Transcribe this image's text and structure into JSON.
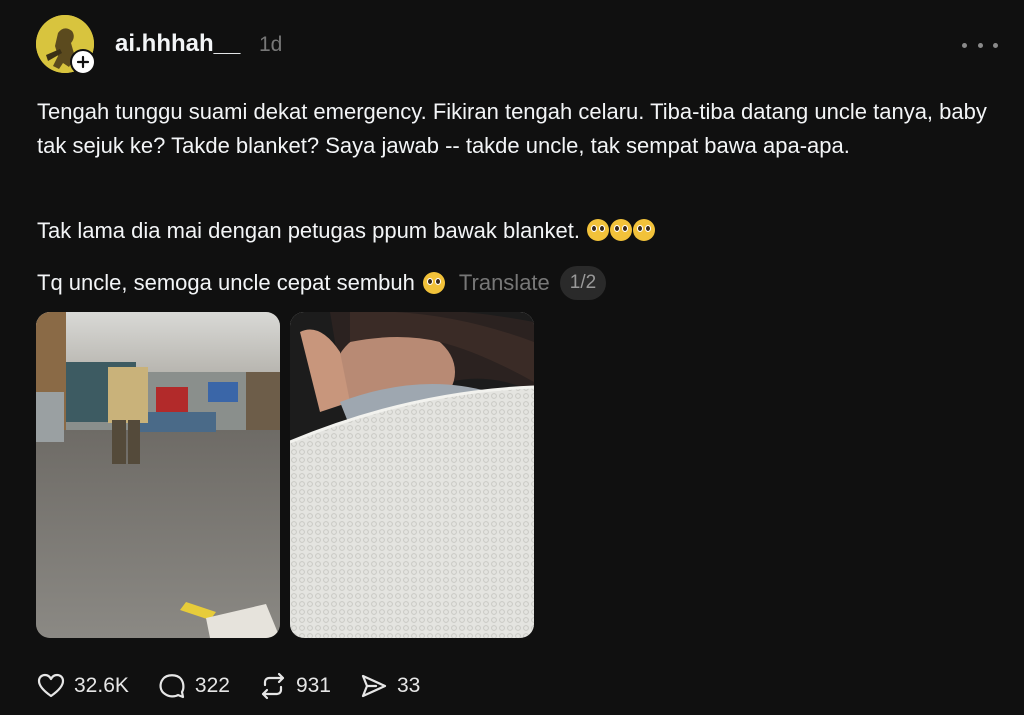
{
  "post": {
    "username": "ai.hhhah__",
    "time": "1d",
    "paragraphs": [
      "Tengah tunggu suami dekat emergency. Fikiran tengah celaru. Tiba-tiba datang uncle tanya, baby tak sejuk ke? Takde blanket? Saya jawab -- takde uncle, tak sempat bawa apa-apa.",
      "Tak lama dia mai dengan petugas ppum bawak blanket.",
      "Tq uncle, semoga uncle cepat sembuh"
    ],
    "translate_label": "Translate",
    "page_indicator": "1/2"
  },
  "actions": {
    "likes": "32.6K",
    "replies": "322",
    "reposts": "931",
    "shares": "33"
  },
  "icons": {
    "more": "more-horizontal-icon",
    "follow": "plus-icon",
    "like": "heart-icon",
    "reply": "comment-icon",
    "repost": "repost-icon",
    "share": "send-icon",
    "emoji": "pleading-face-emoji"
  },
  "colors": {
    "background": "#101010",
    "text": "#f3f5f7",
    "muted": "#777777"
  }
}
